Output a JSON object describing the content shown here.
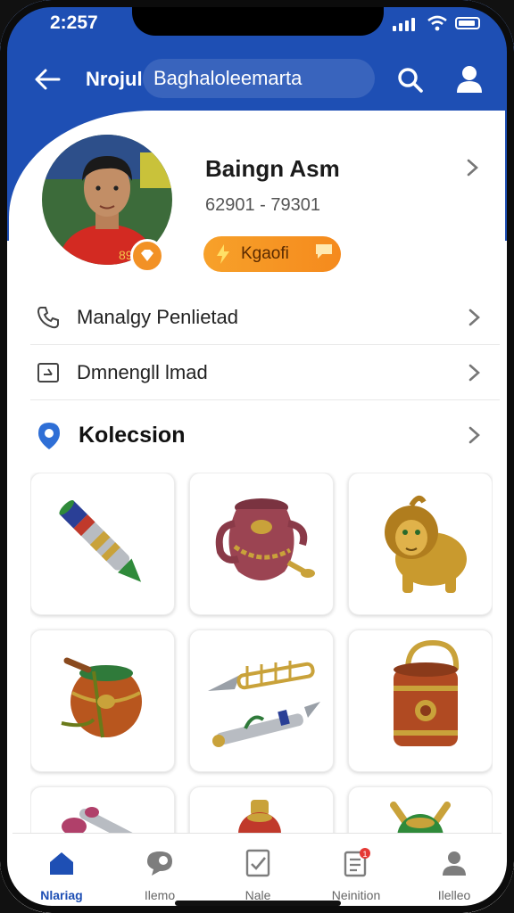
{
  "status": {
    "time": "2:257"
  },
  "appbar": {
    "title": "Nrojul",
    "search_text": "Baghaloleemarta"
  },
  "profile": {
    "name": "Baingn Asm",
    "id_text": "62901 - 79301",
    "action_label": "Kgaofi"
  },
  "menu": [
    {
      "label": "Manalgy Penlietad",
      "icon": "phone-icon"
    },
    {
      "label": "Dmnengll lmad",
      "icon": "edit-icon"
    }
  ],
  "collection": {
    "title": "Kolecsion",
    "icon": "location-pin-icon"
  },
  "items": [
    {
      "icon": "flute-icon"
    },
    {
      "icon": "pot-with-chain-icon"
    },
    {
      "icon": "golden-lion-icon"
    },
    {
      "icon": "bowl-icon"
    },
    {
      "icon": "spears-icon"
    },
    {
      "icon": "lantern-icon"
    },
    {
      "icon": "pin-icon"
    },
    {
      "icon": "vase-icon"
    },
    {
      "icon": "green-pot-icon"
    }
  ],
  "tabs": [
    {
      "label": "Nlariag",
      "icon": "home-icon",
      "active": true
    },
    {
      "label": "Ilemo",
      "icon": "chat-icon",
      "active": false
    },
    {
      "label": "Nale",
      "icon": "document-icon",
      "active": false
    },
    {
      "label": "Neinition",
      "icon": "notification-list-icon",
      "active": false,
      "badge": "1"
    },
    {
      "label": "Ilelleo",
      "icon": "profile-icon",
      "active": false
    }
  ],
  "colors": {
    "primary": "#1e4fb4",
    "accent": "#f58a1d",
    "badge": "#e53935"
  }
}
